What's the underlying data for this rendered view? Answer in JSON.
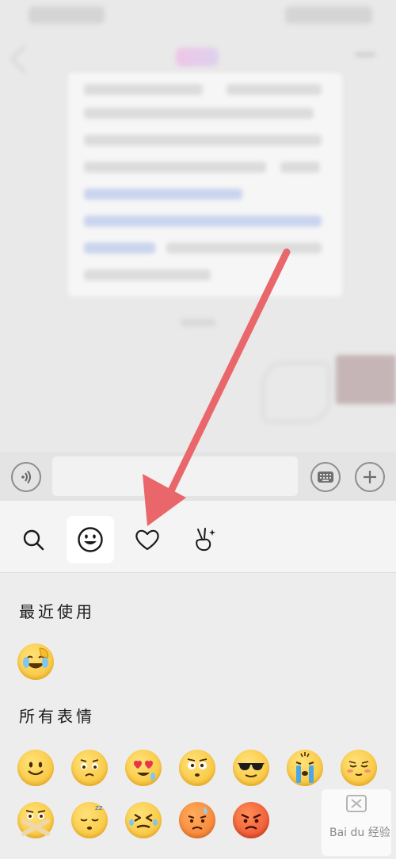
{
  "toolbar": {
    "tools": [
      {
        "icon": "search-icon",
        "active": false
      },
      {
        "icon": "smiley-face-icon",
        "active": true
      },
      {
        "icon": "heart-icon",
        "active": false
      },
      {
        "icon": "sticker-hand-icon",
        "active": false
      }
    ]
  },
  "sections": {
    "recent_title": "最近使用",
    "all_title": "所有表情"
  },
  "recent_emojis": [
    "facepalm-laughing-emoji"
  ],
  "all_emojis": [
    "smile-emoji",
    "worried-emoji",
    "heart-eyes-emoji",
    "surprised-emoji",
    "sunglasses-emoji",
    "crying-emoji",
    "blush-emoji",
    "shush-emoji",
    "sleeping-emoji",
    "squint-tears-emoji",
    "sweat-emoji",
    "angry-emoji"
  ],
  "watermark": {
    "text": "Bai du 经验"
  },
  "colors": {
    "arrow": "#e9676b",
    "panel_bg": "#ededed",
    "toolbar_bg": "#f4f4f4"
  }
}
